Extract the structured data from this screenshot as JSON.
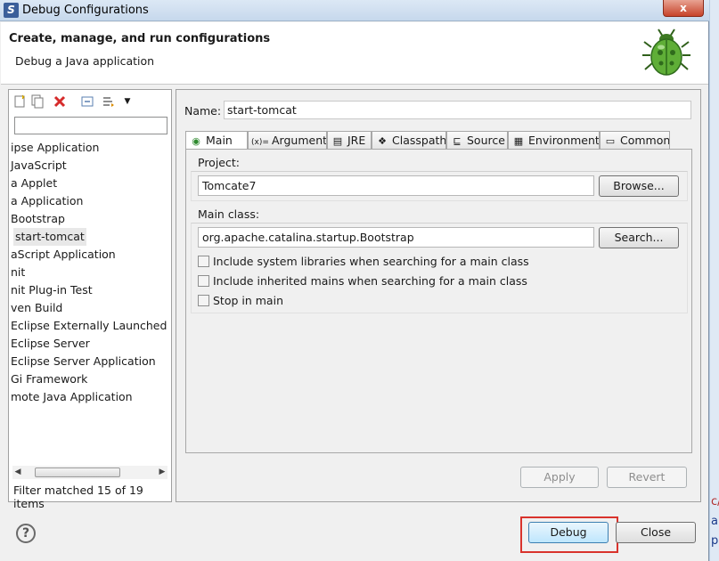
{
  "window": {
    "title": "Debug Configurations",
    "close_glyph": "x"
  },
  "header": {
    "title": "Create, manage, and run configurations",
    "subtitle": "Debug a Java application",
    "icon": "bug-icon"
  },
  "left_panel": {
    "toolbar_icons": [
      "new-config-icon",
      "duplicate-icon",
      "delete-icon",
      "collapse-all-icon",
      "filter-icon",
      "dropdown-arrow-icon"
    ],
    "filter_value": "",
    "tree_items": [
      "ipse Application",
      "JavaScript",
      "a Applet",
      "a Application",
      "Bootstrap",
      "start-tomcat",
      "aScript Application",
      "nit",
      "nit Plug-in Test",
      "ven Build",
      "Eclipse Externally Launched Se",
      "Eclipse Server",
      "Eclipse Server Application",
      "Gi Framework",
      "mote Java Application"
    ],
    "selected_item": "start-tomcat",
    "filter_status": "Filter matched 15 of 19 items"
  },
  "right_panel": {
    "name_label": "Name:",
    "name_value": "start-tomcat",
    "tabs": [
      {
        "label": "Main",
        "icon": "main-tab-icon",
        "glyph": "◉"
      },
      {
        "label": "Arguments",
        "icon": "arguments-icon",
        "glyph": "(x)="
      },
      {
        "label": "JRE",
        "icon": "jre-icon",
        "glyph": "▤"
      },
      {
        "label": "Classpath",
        "icon": "classpath-icon",
        "glyph": "❖"
      },
      {
        "label": "Source",
        "icon": "source-icon",
        "glyph": "⊑"
      },
      {
        "label": "Environment",
        "icon": "environment-icon",
        "glyph": "▦"
      },
      {
        "label": "Common",
        "icon": "common-icon",
        "glyph": "▭"
      }
    ],
    "active_tab": "Main",
    "project": {
      "label": "Project:",
      "value": "Tomcate7",
      "browse_label": "Browse..."
    },
    "main_class": {
      "label": "Main class:",
      "value": "org.apache.catalina.startup.Bootstrap",
      "search_label": "Search..."
    },
    "checkboxes": [
      {
        "label": "Include system libraries when searching for a main class",
        "checked": false
      },
      {
        "label": "Include inherited mains when searching for a main class",
        "checked": false
      },
      {
        "label": "Stop in main",
        "checked": false
      }
    ],
    "apply_label": "Apply",
    "revert_label": "Revert"
  },
  "footer": {
    "help_glyph": "?",
    "debug_label": "Debug",
    "close_label": "Close"
  },
  "background_fragments": [
    "c/",
    "al",
    "p"
  ],
  "colors": {
    "highlight": "#d9332c",
    "delete_icon": "#d62b2b",
    "title_bar": "#c6d8ec"
  }
}
